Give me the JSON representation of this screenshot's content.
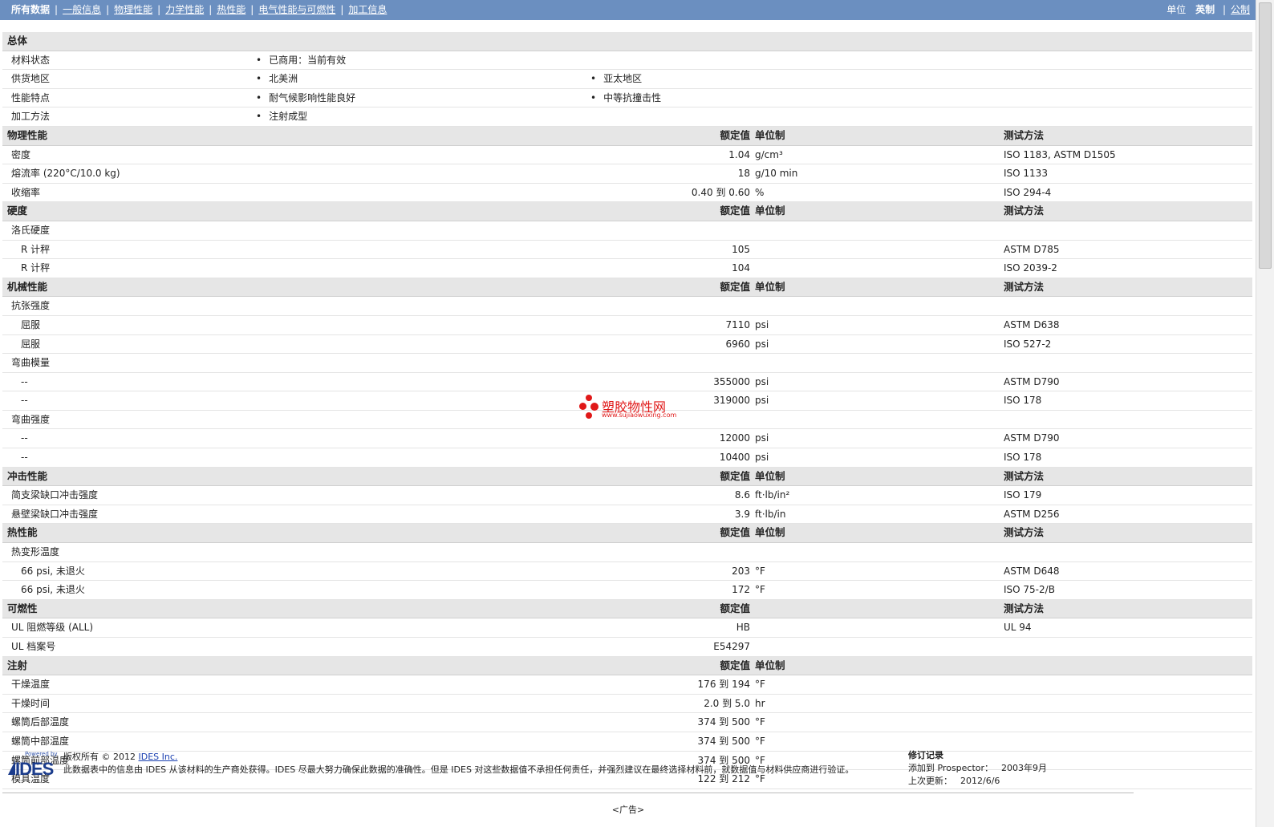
{
  "nav": {
    "tabs": [
      "所有数据",
      "一般信息",
      "物理性能",
      "力学性能",
      "热性能",
      "电气性能与可燃性",
      "加工信息"
    ],
    "units_label": "单位",
    "unit_imperial": "英制",
    "unit_metric": "公制"
  },
  "general": {
    "title": "总体",
    "rows": [
      {
        "label": "材料状态",
        "items": [
          "已商用：当前有效"
        ]
      },
      {
        "label": "供货地区",
        "items": [
          "北美洲",
          "亚太地区"
        ]
      },
      {
        "label": "性能特点",
        "items": [
          "耐气候影响性能良好",
          "中等抗撞击性"
        ]
      },
      {
        "label": "加工方法",
        "items": [
          "注射成型"
        ]
      }
    ]
  },
  "header_cols": {
    "value": "额定值",
    "unit": "单位制",
    "method": "测试方法"
  },
  "sections": [
    {
      "title": "物理性能",
      "cols": [
        "value",
        "unit",
        "method"
      ],
      "rows": [
        {
          "label": "密度",
          "value": "1.04",
          "unit": "g/cm³",
          "method": "ISO 1183, ASTM D1505"
        },
        {
          "label": "熔流率 (220°C/10.0 kg)",
          "value": "18",
          "unit": "g/10 min",
          "method": "ISO 1133"
        },
        {
          "label": "收缩率",
          "value": "0.40 到  0.60",
          "unit": "%",
          "method": "ISO 294-4"
        }
      ]
    },
    {
      "title": "硬度",
      "cols": [
        "value",
        "unit",
        "method"
      ],
      "rows": [
        {
          "label": "洛氏硬度",
          "value": "",
          "unit": "",
          "method": ""
        },
        {
          "label": "R 计秤",
          "sub": true,
          "value": "105",
          "unit": "",
          "method": "ASTM D785"
        },
        {
          "label": "R 计秤",
          "sub": true,
          "value": "104",
          "unit": "",
          "method": "ISO 2039-2"
        }
      ]
    },
    {
      "title": "机械性能",
      "cols": [
        "value",
        "unit",
        "method"
      ],
      "rows": [
        {
          "label": "抗张强度",
          "value": "",
          "unit": "",
          "method": ""
        },
        {
          "label": "屈服",
          "sub": true,
          "value": "7110",
          "unit": "psi",
          "method": "ASTM D638"
        },
        {
          "label": "屈服",
          "sub": true,
          "value": "6960",
          "unit": "psi",
          "method": "ISO 527-2"
        },
        {
          "label": "弯曲模量",
          "value": "",
          "unit": "",
          "method": ""
        },
        {
          "label": "--",
          "sub": true,
          "value": "355000",
          "unit": "psi",
          "method": "ASTM D790"
        },
        {
          "label": "--",
          "sub": true,
          "value": "319000",
          "unit": "psi",
          "method": "ISO 178"
        },
        {
          "label": "弯曲强度",
          "value": "",
          "unit": "",
          "method": ""
        },
        {
          "label": "--",
          "sub": true,
          "value": "12000",
          "unit": "psi",
          "method": "ASTM D790"
        },
        {
          "label": "--",
          "sub": true,
          "value": "10400",
          "unit": "psi",
          "method": "ISO 178"
        }
      ]
    },
    {
      "title": "冲击性能",
      "cols": [
        "value",
        "unit",
        "method"
      ],
      "rows": [
        {
          "label": "简支梁缺口冲击强度",
          "value": "8.6",
          "unit": "ft·lb/in²",
          "method": "ISO 179"
        },
        {
          "label": "悬壁梁缺口冲击强度",
          "value": "3.9",
          "unit": "ft·lb/in",
          "method": "ASTM D256"
        }
      ]
    },
    {
      "title": "热性能",
      "cols": [
        "value",
        "unit",
        "method"
      ],
      "rows": [
        {
          "label": "热变形温度",
          "value": "",
          "unit": "",
          "method": ""
        },
        {
          "label": "66 psi, 未退火",
          "sub": true,
          "value": "203",
          "unit": "°F",
          "method": "ASTM D648"
        },
        {
          "label": "66 psi, 未退火",
          "sub": true,
          "value": "172",
          "unit": "°F",
          "method": "ISO 75-2/B"
        }
      ]
    },
    {
      "title": "可燃性",
      "cols": [
        "value",
        "method"
      ],
      "rows": [
        {
          "label": "UL 阻燃等级 (ALL)",
          "value": "HB",
          "unit": "",
          "method": "UL 94"
        },
        {
          "label": "UL 档案号",
          "value": "E54297",
          "unit": "",
          "method": ""
        }
      ]
    },
    {
      "title": "注射",
      "cols": [
        "value",
        "unit"
      ],
      "rows": [
        {
          "label": "干燥温度",
          "value": "176 到  194",
          "unit": "°F",
          "method": ""
        },
        {
          "label": "干燥时间",
          "value": "2.0 到  5.0",
          "unit": "hr",
          "method": ""
        },
        {
          "label": "螺筒后部温度",
          "value": "374 到  500",
          "unit": "°F",
          "method": ""
        },
        {
          "label": "螺筒中部温度",
          "value": "374 到  500",
          "unit": "°F",
          "method": ""
        },
        {
          "label": "螺筒前部温度",
          "value": "374 到  500",
          "unit": "°F",
          "method": ""
        },
        {
          "label": "模具温度",
          "value": "122 到  212",
          "unit": "°F",
          "method": ""
        }
      ]
    }
  ],
  "footer": {
    "logo_powered": "Powered by",
    "logo_name": "IDES",
    "copyright": "版权所有 © 2012",
    "company_link": "IDES Inc.",
    "disclaimer": "此数据表中的信息由 IDES 从该材料的生产商处获得。IDES 尽最大努力确保此数据的准确性。但是 IDES 对这些数据值不承担任何责任，并强烈建议在最终选择材料前，就数据值与材料供应商进行验证。",
    "revision_title": "修订记录",
    "added_label": "添加到 Prospector：",
    "added_value": "2003年9月",
    "updated_label": "上次更新：",
    "updated_value": "2012/6/6"
  },
  "watermark": {
    "name": "塑胶物性网",
    "url": "www.sujiaowuxing.com"
  },
  "ad_label": "<广告>",
  "colors": {
    "nav_bg": "#6b8fc0",
    "section_bg": "#e6e6e6",
    "watermark": "#e01818",
    "logo": "#1b3c8c"
  }
}
